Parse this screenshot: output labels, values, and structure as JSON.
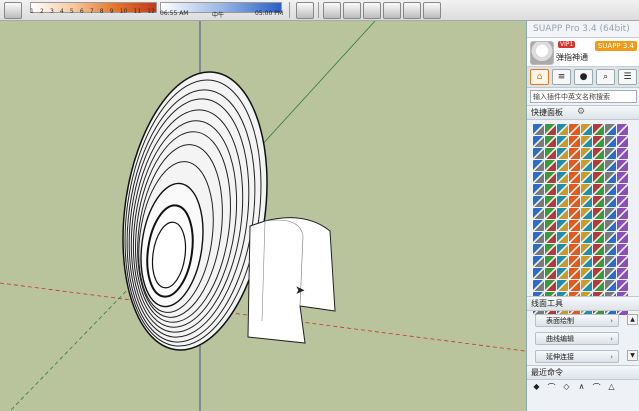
{
  "toolbar": {
    "shadow_ticks": [
      "1",
      "2",
      "3",
      "4",
      "5",
      "6",
      "7",
      "8",
      "9",
      "10",
      "11",
      "12"
    ],
    "time_start": "06:55 AM",
    "time_mid": "中午",
    "time_end": "05:00 PM",
    "icons": [
      "eraser-icon",
      "group-icon",
      "iso-view-icon",
      "top-view-icon",
      "front-view-icon",
      "right-view-icon",
      "back-view-icon",
      "left-view-icon"
    ]
  },
  "panel": {
    "title": "SUAPP Pro 3.4 (64bit)",
    "vip_badge": "VIP1",
    "username": "弹指神通",
    "version_badge": "SUAPP 3.4",
    "nav_tabs": [
      "home-icon",
      "list-icon",
      "user-icon",
      "search-icon",
      "menu-icon"
    ],
    "search_placeholder": "输入插件中英文名称搜索",
    "quick_panel_label": "快捷面板",
    "tool_icon_count": 128,
    "section_line_tools": "线面工具",
    "buttons": [
      "表面绘制",
      "曲线编辑",
      "延伸连接"
    ],
    "section_near": "最近命令",
    "near_icons": [
      "◆",
      "⌒",
      "◇",
      "∧",
      "⌒",
      "△"
    ]
  },
  "colors": {
    "viewport_bg": "#b9c49c",
    "accent_orange": "#f09a18",
    "red_axis": "#c0392b",
    "green_axis": "#2e7d32",
    "blue_axis": "#1a3a8a"
  }
}
